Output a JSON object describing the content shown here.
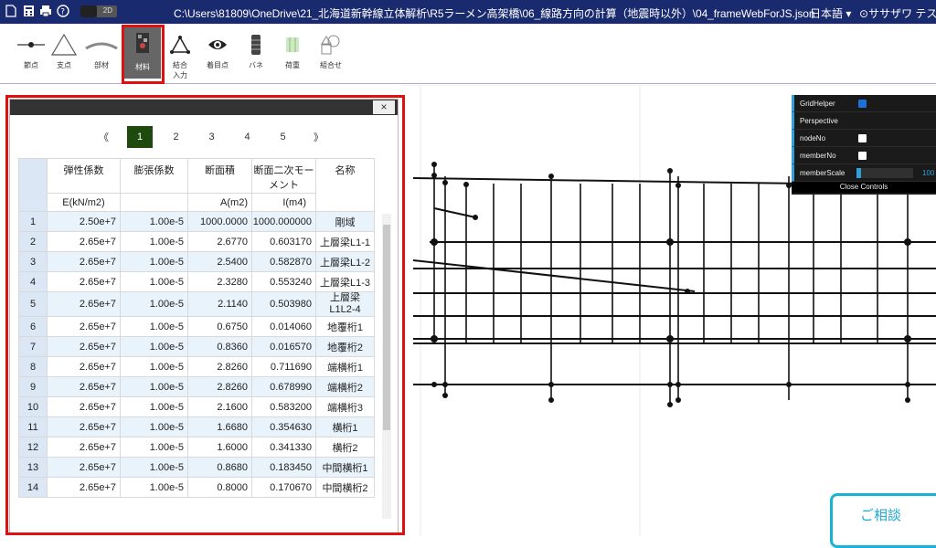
{
  "titlebar": {
    "toggle_label": "2D",
    "filepath": "C:\\Users\\81809\\OneDrive\\21_北海道新幹線立体解析\\R5ラーメン高架橋\\06_線路方向の計算（地震時以外）\\04_frameWebForJS.json",
    "language": "日本語",
    "user": "ササザワ テス"
  },
  "toolbar": {
    "tools": [
      {
        "label": "節点"
      },
      {
        "label": "支点"
      },
      {
        "label": "部材"
      },
      {
        "label": "材料"
      },
      {
        "label": "結合",
        "sub": "入力"
      },
      {
        "label": "着目点"
      },
      {
        "label": "バネ"
      },
      {
        "label": "荷重"
      },
      {
        "label": "組合せ"
      }
    ]
  },
  "panel": {
    "close": "×",
    "pager": {
      "first": "《",
      "pages": [
        "1",
        "2",
        "3",
        "4",
        "5"
      ],
      "last": "》"
    },
    "headers": {
      "c1": "弾性係数",
      "c2": "膨張係数",
      "c3": "断面積",
      "c4": "断面二次モーメント",
      "c5": "名称",
      "u1": "E(kN/m2)",
      "u2": "",
      "u3": "A(m2)",
      "u4": "I(m4)"
    },
    "rows": [
      {
        "no": "1",
        "e": "2.50e+7",
        "a": "1.00e-5",
        "area": "1000.0000",
        "i": "1000.000000",
        "name": "剛域"
      },
      {
        "no": "2",
        "e": "2.65e+7",
        "a": "1.00e-5",
        "area": "2.6770",
        "i": "0.603170",
        "name": "上層梁L1-1"
      },
      {
        "no": "3",
        "e": "2.65e+7",
        "a": "1.00e-5",
        "area": "2.5400",
        "i": "0.582870",
        "name": "上層梁L1-2"
      },
      {
        "no": "4",
        "e": "2.65e+7",
        "a": "1.00e-5",
        "area": "2.3280",
        "i": "0.553240",
        "name": "上層梁L1-3"
      },
      {
        "no": "5",
        "e": "2.65e+7",
        "a": "1.00e-5",
        "area": "2.1140",
        "i": "0.503980",
        "name": "上層梁L1L2-4"
      },
      {
        "no": "6",
        "e": "2.65e+7",
        "a": "1.00e-5",
        "area": "0.6750",
        "i": "0.014060",
        "name": "地覆桁1"
      },
      {
        "no": "7",
        "e": "2.65e+7",
        "a": "1.00e-5",
        "area": "0.8360",
        "i": "0.016570",
        "name": "地覆桁2"
      },
      {
        "no": "8",
        "e": "2.65e+7",
        "a": "1.00e-5",
        "area": "2.8260",
        "i": "0.711690",
        "name": "端横桁1"
      },
      {
        "no": "9",
        "e": "2.65e+7",
        "a": "1.00e-5",
        "area": "2.8260",
        "i": "0.678990",
        "name": "端横桁2"
      },
      {
        "no": "10",
        "e": "2.65e+7",
        "a": "1.00e-5",
        "area": "2.1600",
        "i": "0.583200",
        "name": "端横桁3"
      },
      {
        "no": "11",
        "e": "2.65e+7",
        "a": "1.00e-5",
        "area": "1.6680",
        "i": "0.354630",
        "name": "横桁1"
      },
      {
        "no": "12",
        "e": "2.65e+7",
        "a": "1.00e-5",
        "area": "1.6000",
        "i": "0.341330",
        "name": "横桁2"
      },
      {
        "no": "13",
        "e": "2.65e+7",
        "a": "1.00e-5",
        "area": "0.8680",
        "i": "0.183450",
        "name": "中間横桁1"
      },
      {
        "no": "14",
        "e": "2.65e+7",
        "a": "1.00e-5",
        "area": "0.8000",
        "i": "0.170670",
        "name": "中間横桁2"
      }
    ]
  },
  "controls": {
    "grid_helper": "GridHelper",
    "perspective": "Perspective",
    "node_no": "nodeNo",
    "member_no": "memberNo",
    "member_scale": "memberScale",
    "member_scale_value": "100",
    "close": "Close Controls"
  },
  "consult": {
    "label": "ご相談"
  },
  "colors": {
    "titlebar": "#1a2a6e",
    "highlight": "#e01010",
    "page_active": "#1f4a0e",
    "accent": "#2fa1d6"
  }
}
